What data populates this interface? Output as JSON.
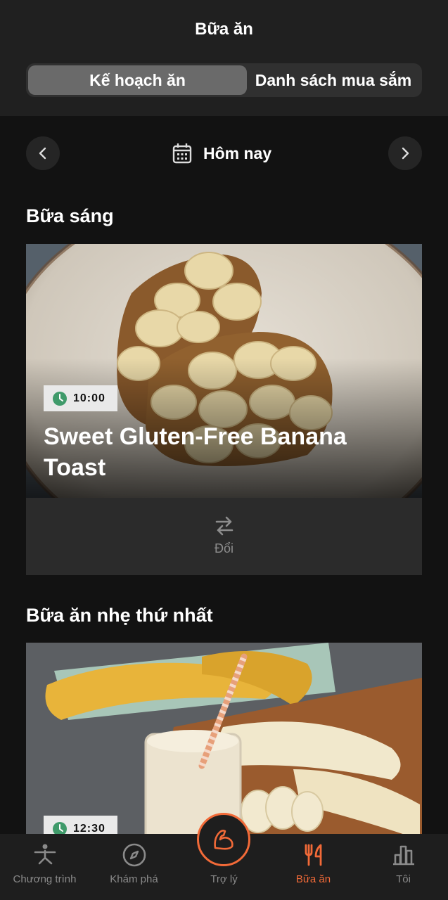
{
  "header": {
    "title": "Bữa ăn",
    "tabs": [
      {
        "label": "Kế hoạch ăn",
        "active": true
      },
      {
        "label": "Danh sách mua sắm",
        "active": false
      }
    ]
  },
  "date_nav": {
    "label": "Hôm nay",
    "prev_icon": "chevron-left-icon",
    "next_icon": "chevron-right-icon",
    "calendar_icon": "calendar-icon"
  },
  "meals": [
    {
      "section": "Bữa sáng",
      "time": "10:00",
      "title": "Sweet Gluten-Free Banana Toast",
      "swap_label": "Đổi"
    },
    {
      "section": "Bữa ăn nhẹ thứ nhất",
      "time": "12:30",
      "title": ""
    }
  ],
  "tabbar": {
    "items": [
      {
        "label": "Chương trình",
        "icon": "yoga-pose-icon",
        "active": false
      },
      {
        "label": "Khám phá",
        "icon": "compass-icon",
        "active": false
      },
      {
        "label": "Trợ lý",
        "icon": "flexed-arm-icon",
        "active": false
      },
      {
        "label": "Bữa ăn",
        "icon": "fork-knife-icon",
        "active": true
      },
      {
        "label": "Tôi",
        "icon": "bar-chart-icon",
        "active": false
      }
    ]
  },
  "colors": {
    "accent": "#f26a38",
    "badge_clock": "#3f9a6a",
    "background": "#121212"
  }
}
